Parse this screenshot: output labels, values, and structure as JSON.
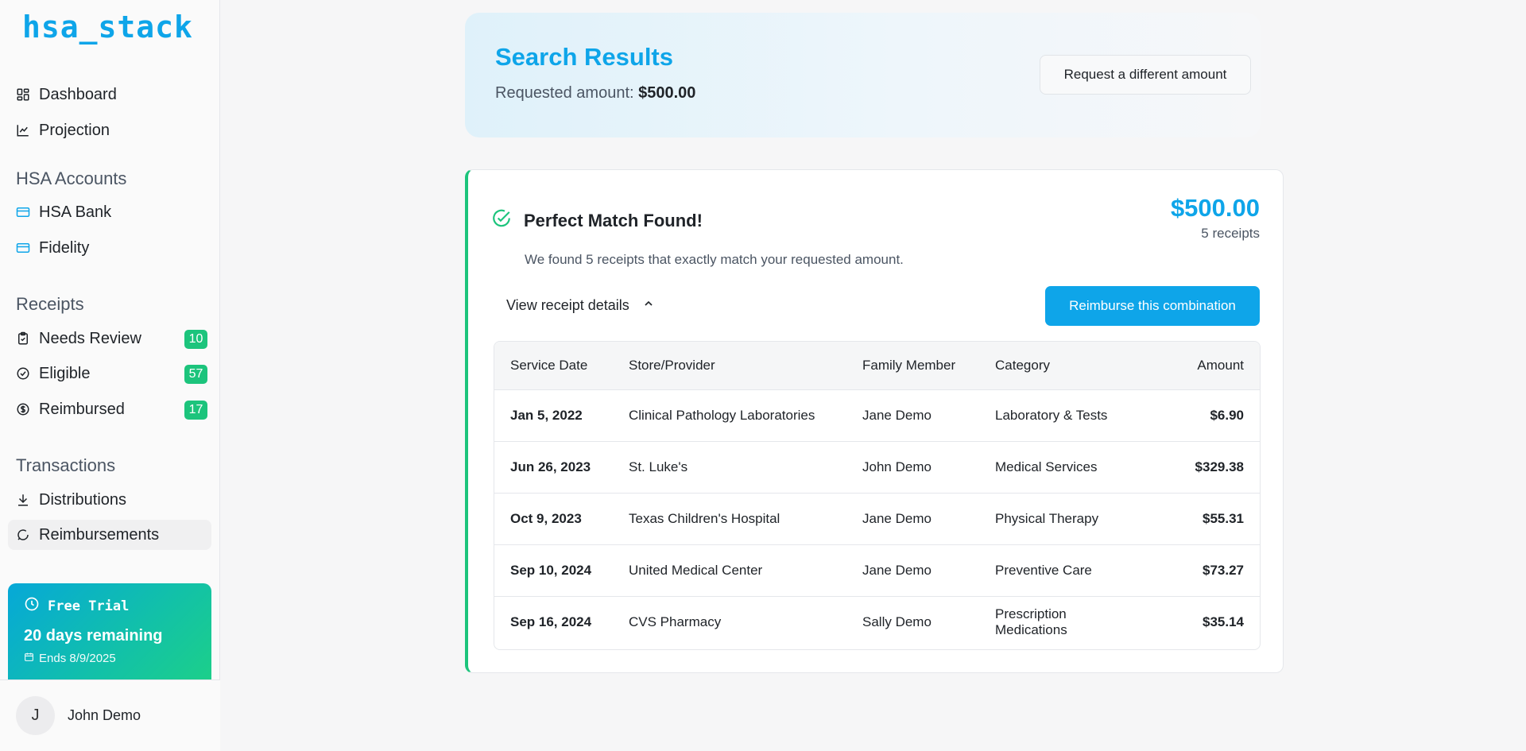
{
  "app": {
    "logo": "hsa_stack"
  },
  "sidebar": {
    "main_items": [
      {
        "label": "Dashboard",
        "icon": "dashboard-icon"
      },
      {
        "label": "Projection",
        "icon": "chart-line-icon"
      }
    ],
    "hsa_section": {
      "title": "HSA Accounts",
      "items": [
        {
          "label": "HSA Bank",
          "icon": "card-icon"
        },
        {
          "label": "Fidelity",
          "icon": "card-icon"
        }
      ]
    },
    "receipts_section": {
      "title": "Receipts",
      "items": [
        {
          "label": "Needs Review",
          "count": "10",
          "icon": "clipboard-check-icon"
        },
        {
          "label": "Eligible",
          "count": "57",
          "icon": "check-circle-icon"
        },
        {
          "label": "Reimbursed",
          "count": "17",
          "icon": "dollar-circle-icon"
        }
      ]
    },
    "transactions_section": {
      "title": "Transactions",
      "items": [
        {
          "label": "Distributions",
          "icon": "download-icon"
        },
        {
          "label": "Reimbursements",
          "icon": "refresh-icon",
          "active": true
        }
      ]
    },
    "trial": {
      "title": "Free Trial",
      "days": "20 days remaining",
      "ends": "Ends 8/9/2025"
    },
    "user": {
      "initial": "J",
      "name": "John Demo"
    }
  },
  "header": {
    "title": "Search Results",
    "requested_label": "Requested amount:",
    "requested_value": "$500.00",
    "change_button": "Request a different amount"
  },
  "result": {
    "title": "Perfect Match Found!",
    "total": "$500.00",
    "receipt_count": "5 receipts",
    "description": "We found 5 receipts that exactly match your requested amount.",
    "details_toggle": "View receipt details",
    "reimburse_button": "Reimburse this combination",
    "columns": [
      "Service Date",
      "Store/Provider",
      "Family Member",
      "Category",
      "Amount"
    ],
    "rows": [
      {
        "date": "Jan 5, 2022",
        "provider": "Clinical Pathology Laboratories",
        "member": "Jane Demo",
        "category": "Laboratory & Tests",
        "amount": "$6.90"
      },
      {
        "date": "Jun 26, 2023",
        "provider": "St. Luke's",
        "member": "John Demo",
        "category": "Medical Services",
        "amount": "$329.38"
      },
      {
        "date": "Oct 9, 2023",
        "provider": "Texas Children's Hospital",
        "member": "Jane Demo",
        "category": "Physical Therapy",
        "amount": "$55.31"
      },
      {
        "date": "Sep 10, 2024",
        "provider": "United Medical Center",
        "member": "Jane Demo",
        "category": "Preventive Care",
        "amount": "$73.27"
      },
      {
        "date": "Sep 16, 2024",
        "provider": "CVS Pharmacy",
        "member": "Sally Demo",
        "category": "Prescription Medications",
        "amount": "$35.14"
      }
    ]
  },
  "colors": {
    "accent": "#0ea5e9",
    "success": "#1cc47c"
  }
}
